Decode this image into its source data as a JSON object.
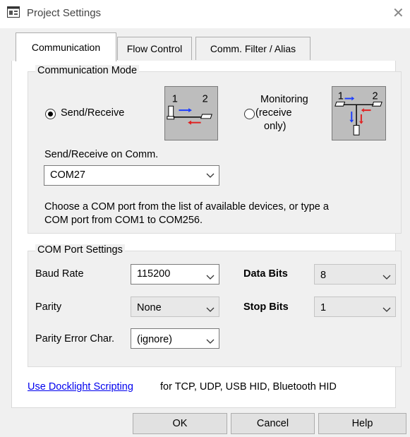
{
  "window": {
    "title": "Project Settings",
    "close_glyph": "✕"
  },
  "tabs": [
    {
      "label": "Communication",
      "active": true
    },
    {
      "label": "Flow Control",
      "active": false
    },
    {
      "label": "Comm. Filter / Alias",
      "active": false
    }
  ],
  "communication_mode": {
    "legend": "Communication Mode",
    "send_receive_label": "Send/Receive",
    "monitoring_label_line1": "Monitoring",
    "monitoring_label_line2": "(receive",
    "monitoring_label_line3": "only)",
    "diagram_label_1": "1",
    "diagram_label_2": "2",
    "selected": "send_receive",
    "comm_label": "Send/Receive on Comm.",
    "comm_value": "COM27",
    "help_text_line1": "Choose a COM port from the list of available devices, or type a",
    "help_text_line2": "COM port from COM1 to COM256."
  },
  "port_settings": {
    "legend": "COM Port Settings",
    "baud_rate_label": "Baud Rate",
    "baud_rate_value": "115200",
    "data_bits_label": "Data Bits",
    "data_bits_value": "8",
    "parity_label": "Parity",
    "parity_value": "None",
    "stop_bits_label": "Stop Bits",
    "stop_bits_value": "1",
    "parity_error_label": "Parity Error Char.",
    "parity_error_value": "(ignore)"
  },
  "scripting": {
    "link_text": "Use Docklight Scripting",
    "note": "for TCP, UDP, USB HID, Bluetooth HID"
  },
  "buttons": {
    "ok": "OK",
    "cancel": "Cancel",
    "help": "Help"
  },
  "colors": {
    "arrow_send": "#1a3cff",
    "arrow_receive": "#e02020",
    "link": "#0000ee"
  }
}
